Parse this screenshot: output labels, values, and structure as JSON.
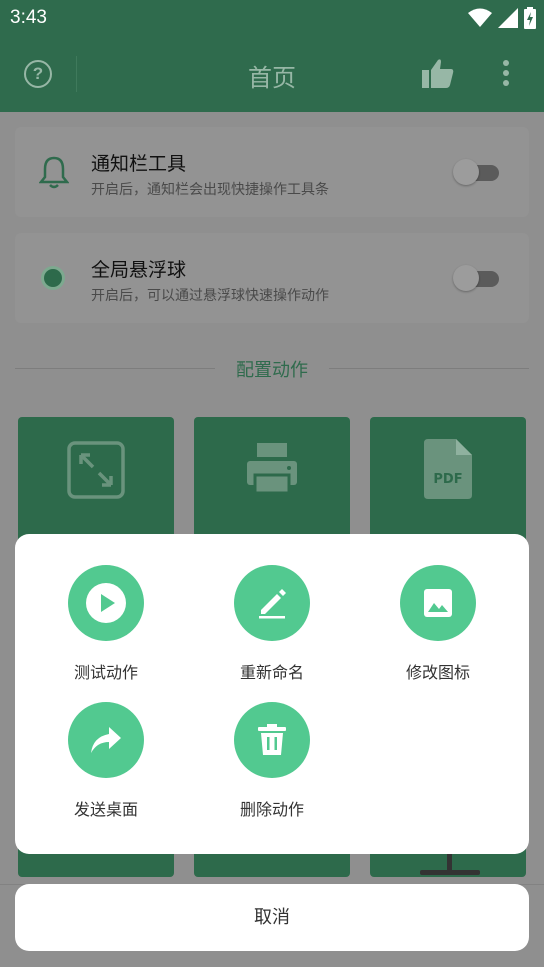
{
  "status_bar": {
    "time": "3:43"
  },
  "app_bar": {
    "title": "首页",
    "help_glyph": "?"
  },
  "cards": [
    {
      "title": "通知栏工具",
      "subtitle": "开启后，通知栏会出现快捷操作工具条",
      "icon": "bell-icon",
      "enabled": false
    },
    {
      "title": "全局悬浮球",
      "subtitle": "开启后，可以通过悬浮球快速操作动作",
      "icon": "dot-icon",
      "enabled": false
    }
  ],
  "section": {
    "title": "配置动作"
  },
  "dialog": {
    "actions": [
      {
        "label": "测试动作",
        "icon": "play-icon"
      },
      {
        "label": "重新命名",
        "icon": "edit-icon"
      },
      {
        "label": "修改图标",
        "icon": "image-icon"
      },
      {
        "label": "发送桌面",
        "icon": "share-icon"
      },
      {
        "label": "删除动作",
        "icon": "trash-icon"
      }
    ],
    "cancel_label": "取消"
  },
  "colors": {
    "primary": "#2f6b4d",
    "accent": "#52c990"
  }
}
